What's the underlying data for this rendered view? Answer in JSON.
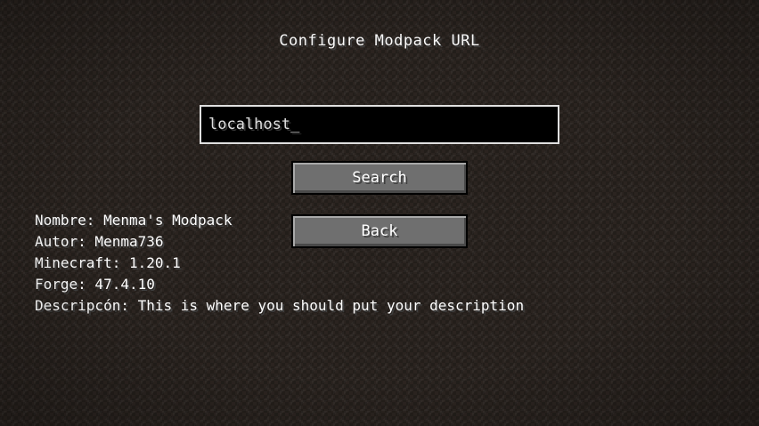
{
  "screen": {
    "title": "Configure Modpack URL"
  },
  "url_field": {
    "value": "localhost_"
  },
  "buttons": {
    "search_label": "Search",
    "back_label": "Back"
  },
  "modpack_info": {
    "lines": [
      "Nombre: Menma's Modpack",
      "Autor: Menma736",
      "Minecraft: 1.20.1",
      "Forge: 47.4.10",
      "Descripcón: This is where you should put your description"
    ]
  },
  "colors": {
    "background": "#2b2420",
    "button": "#6f6f6f",
    "input_bg": "#000000",
    "input_border": "#e0e0e0",
    "text": "#ffffff"
  }
}
